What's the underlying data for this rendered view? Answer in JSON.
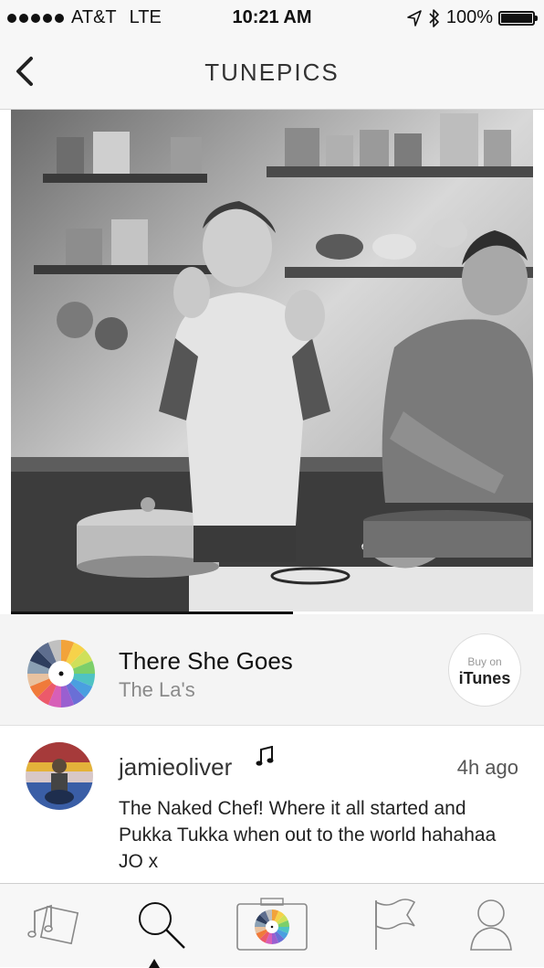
{
  "status_bar": {
    "carrier": "AT&T",
    "network": "LTE",
    "time": "10:21 AM",
    "battery_percent": "100%",
    "icons": [
      "signal-dots-icon",
      "location-arrow-icon",
      "bluetooth-icon",
      "battery-icon"
    ]
  },
  "nav": {
    "title": "TUNEPICS",
    "back_icon": "chevron-left-icon"
  },
  "photo": {
    "playback_progress": 0.54
  },
  "song": {
    "title": "There She Goes",
    "artist": "The La's",
    "buy_small": "Buy on",
    "buy_big": "iTunes"
  },
  "post": {
    "username": "jamieoliver",
    "timestamp": "4h ago",
    "caption": "The Naked Chef! Where it all started and Pukka Tukka when out to the world hahahaa JO x"
  },
  "tabs": [
    {
      "icon": "music-notes-icon",
      "selected": false
    },
    {
      "icon": "search-icon",
      "selected": true
    },
    {
      "icon": "camera-icon",
      "selected": false
    },
    {
      "icon": "flag-icon",
      "selected": false
    },
    {
      "icon": "profile-icon",
      "selected": false
    }
  ],
  "colors": {
    "bars": "#f7f7f7",
    "accent": "#111111",
    "muted_text": "#8a8a8a"
  }
}
